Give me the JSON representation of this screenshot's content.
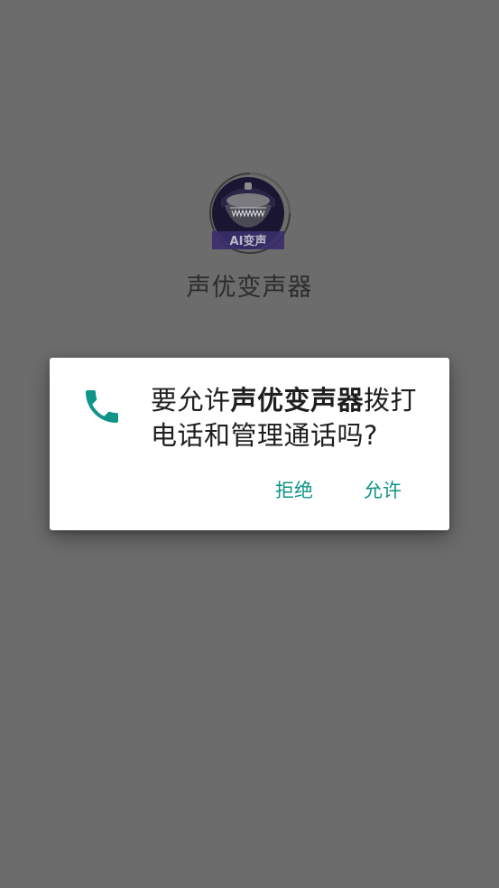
{
  "splash": {
    "app_name": "声优变声器",
    "logo_badge_text": "AI变声"
  },
  "dialog": {
    "icon": "phone-icon",
    "message_prefix": "要允许",
    "message_app": "声优变声器",
    "message_suffix": "拨打电话和管理通话吗?",
    "deny_label": "拒绝",
    "allow_label": "允许"
  },
  "colors": {
    "scrim": "#6c6c6c",
    "accent": "#0f9488",
    "dialog_bg": "#ffffff",
    "text": "#1f1f1f"
  }
}
